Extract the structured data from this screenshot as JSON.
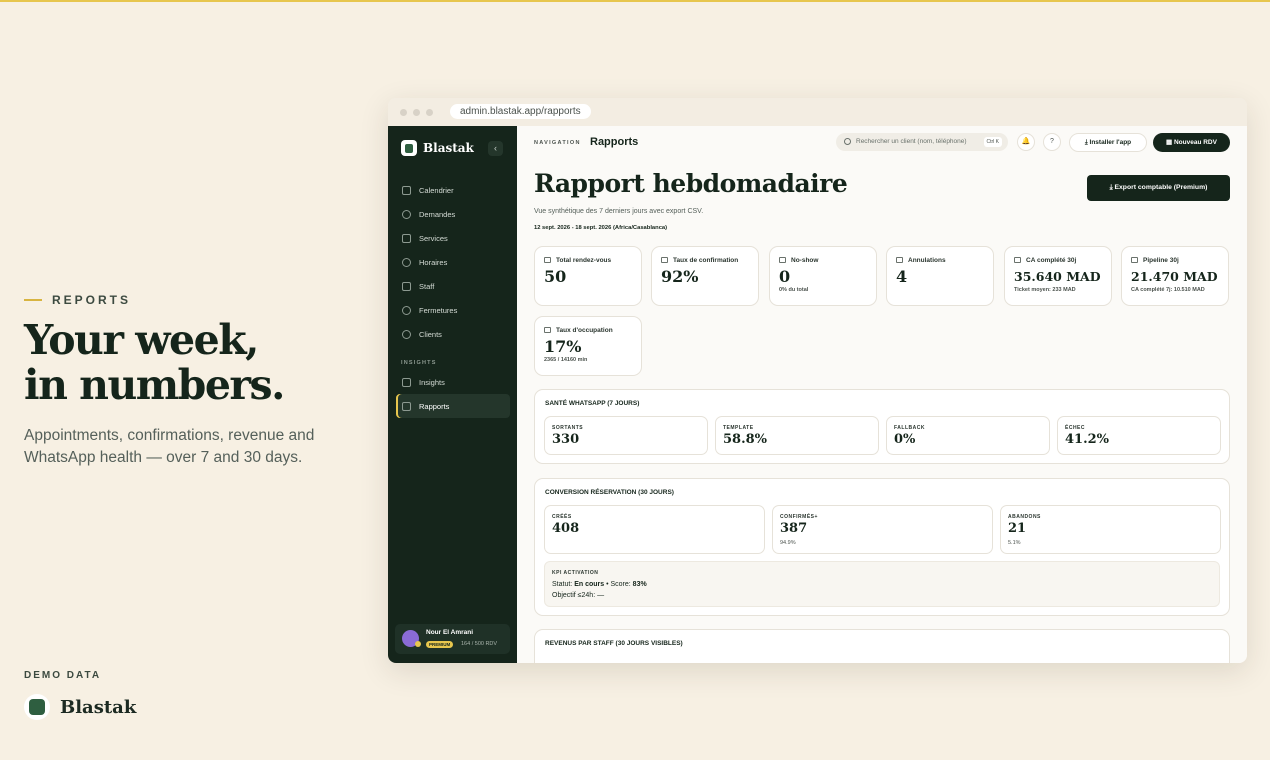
{
  "hero": {
    "eyebrow": "REPORTS",
    "headline_1": "Your week,",
    "headline_2": "in numbers.",
    "lead": "Appointments, confirmations, revenue and WhatsApp health — over 7 and 30 days.",
    "demo_label": "DEMO DATA",
    "brand": "Blastak"
  },
  "browser": {
    "url": "admin.blastak.app/rapports"
  },
  "sidebar": {
    "brand": "Blastak",
    "collapse_glyph": "‹",
    "items": [
      {
        "label": "Calendrier",
        "icon": "calendar-icon"
      },
      {
        "label": "Demandes",
        "icon": "check-circle-icon"
      },
      {
        "label": "Services",
        "icon": "scissors-icon"
      },
      {
        "label": "Horaires",
        "icon": "clock-icon"
      },
      {
        "label": "Staff",
        "icon": "building-icon"
      },
      {
        "label": "Fermetures",
        "icon": "ban-icon"
      },
      {
        "label": "Clients",
        "icon": "users-icon"
      }
    ],
    "section": "INSIGHTS",
    "insights": [
      {
        "label": "Insights",
        "icon": "bar-chart-icon"
      },
      {
        "label": "Rapports",
        "icon": "bar-chart-icon"
      }
    ],
    "user": {
      "name": "Nour El Amrani",
      "plan": "PREMIUM",
      "usage": "164 / 500 RDV"
    }
  },
  "topbar": {
    "nav_label": "NAVIGATION",
    "crumb": "Rapports",
    "search_placeholder": "Rechercher un client (nom, téléphone)",
    "search_kbd": "Ctrl K",
    "bell_glyph": "🔔",
    "help_glyph": "?",
    "install_label": "Installer l'app",
    "new_label": "Nouveau RDV"
  },
  "page": {
    "title": "Rapport hebdomadaire",
    "subtitle": "Vue synthétique des 7 derniers jours avec export CSV.",
    "date_range": "12 sept. 2026 - 18 sept. 2026 (Africa/Casablanca)",
    "export_label": "Export comptable (Premium)"
  },
  "kpis": [
    {
      "label": "Total rendez-vous",
      "value": "50",
      "note": ""
    },
    {
      "label": "Taux de confirmation",
      "value": "92%",
      "note": ""
    },
    {
      "label": "No-show",
      "value": "0",
      "note": "0% du total"
    },
    {
      "label": "Annulations",
      "value": "4",
      "note": ""
    },
    {
      "label": "CA complété 30j",
      "value": "35.640 MAD",
      "note": "Ticket moyen: 233 MAD"
    },
    {
      "label": "Pipeline 30j",
      "value": "21.470 MAD",
      "note": "CA complété 7j: 10.510 MAD"
    },
    {
      "label": "Taux d'occupation",
      "value": "17%",
      "note": "2365 / 14160 min"
    }
  ],
  "whatsapp": {
    "title": "SANTÉ WHATSAPP (7 JOURS)",
    "items": [
      {
        "label": "SORTANTS",
        "value": "330"
      },
      {
        "label": "TEMPLATE",
        "value": "58.8%"
      },
      {
        "label": "FALLBACK",
        "value": "0%"
      },
      {
        "label": "ÉCHEC",
        "value": "41.2%"
      }
    ]
  },
  "conversion": {
    "title": "CONVERSION RÉSERVATION (30 JOURS)",
    "items": [
      {
        "label": "CRÉÉS",
        "value": "408",
        "note": ""
      },
      {
        "label": "CONFIRMÉS+",
        "value": "387",
        "note": "94.9%"
      },
      {
        "label": "ABANDONS",
        "value": "21",
        "note": "5.1%"
      }
    ],
    "activation": {
      "label": "KPI ACTIVATION",
      "status_prefix": "Statut: ",
      "status": "En cours",
      "score_prefix": " • Score: ",
      "score": "83%",
      "objective": "Objectif ≤24h: —"
    }
  },
  "staff_revenue": {
    "title": "REVENUS PAR STAFF (30 JOURS VISIBLES)"
  }
}
